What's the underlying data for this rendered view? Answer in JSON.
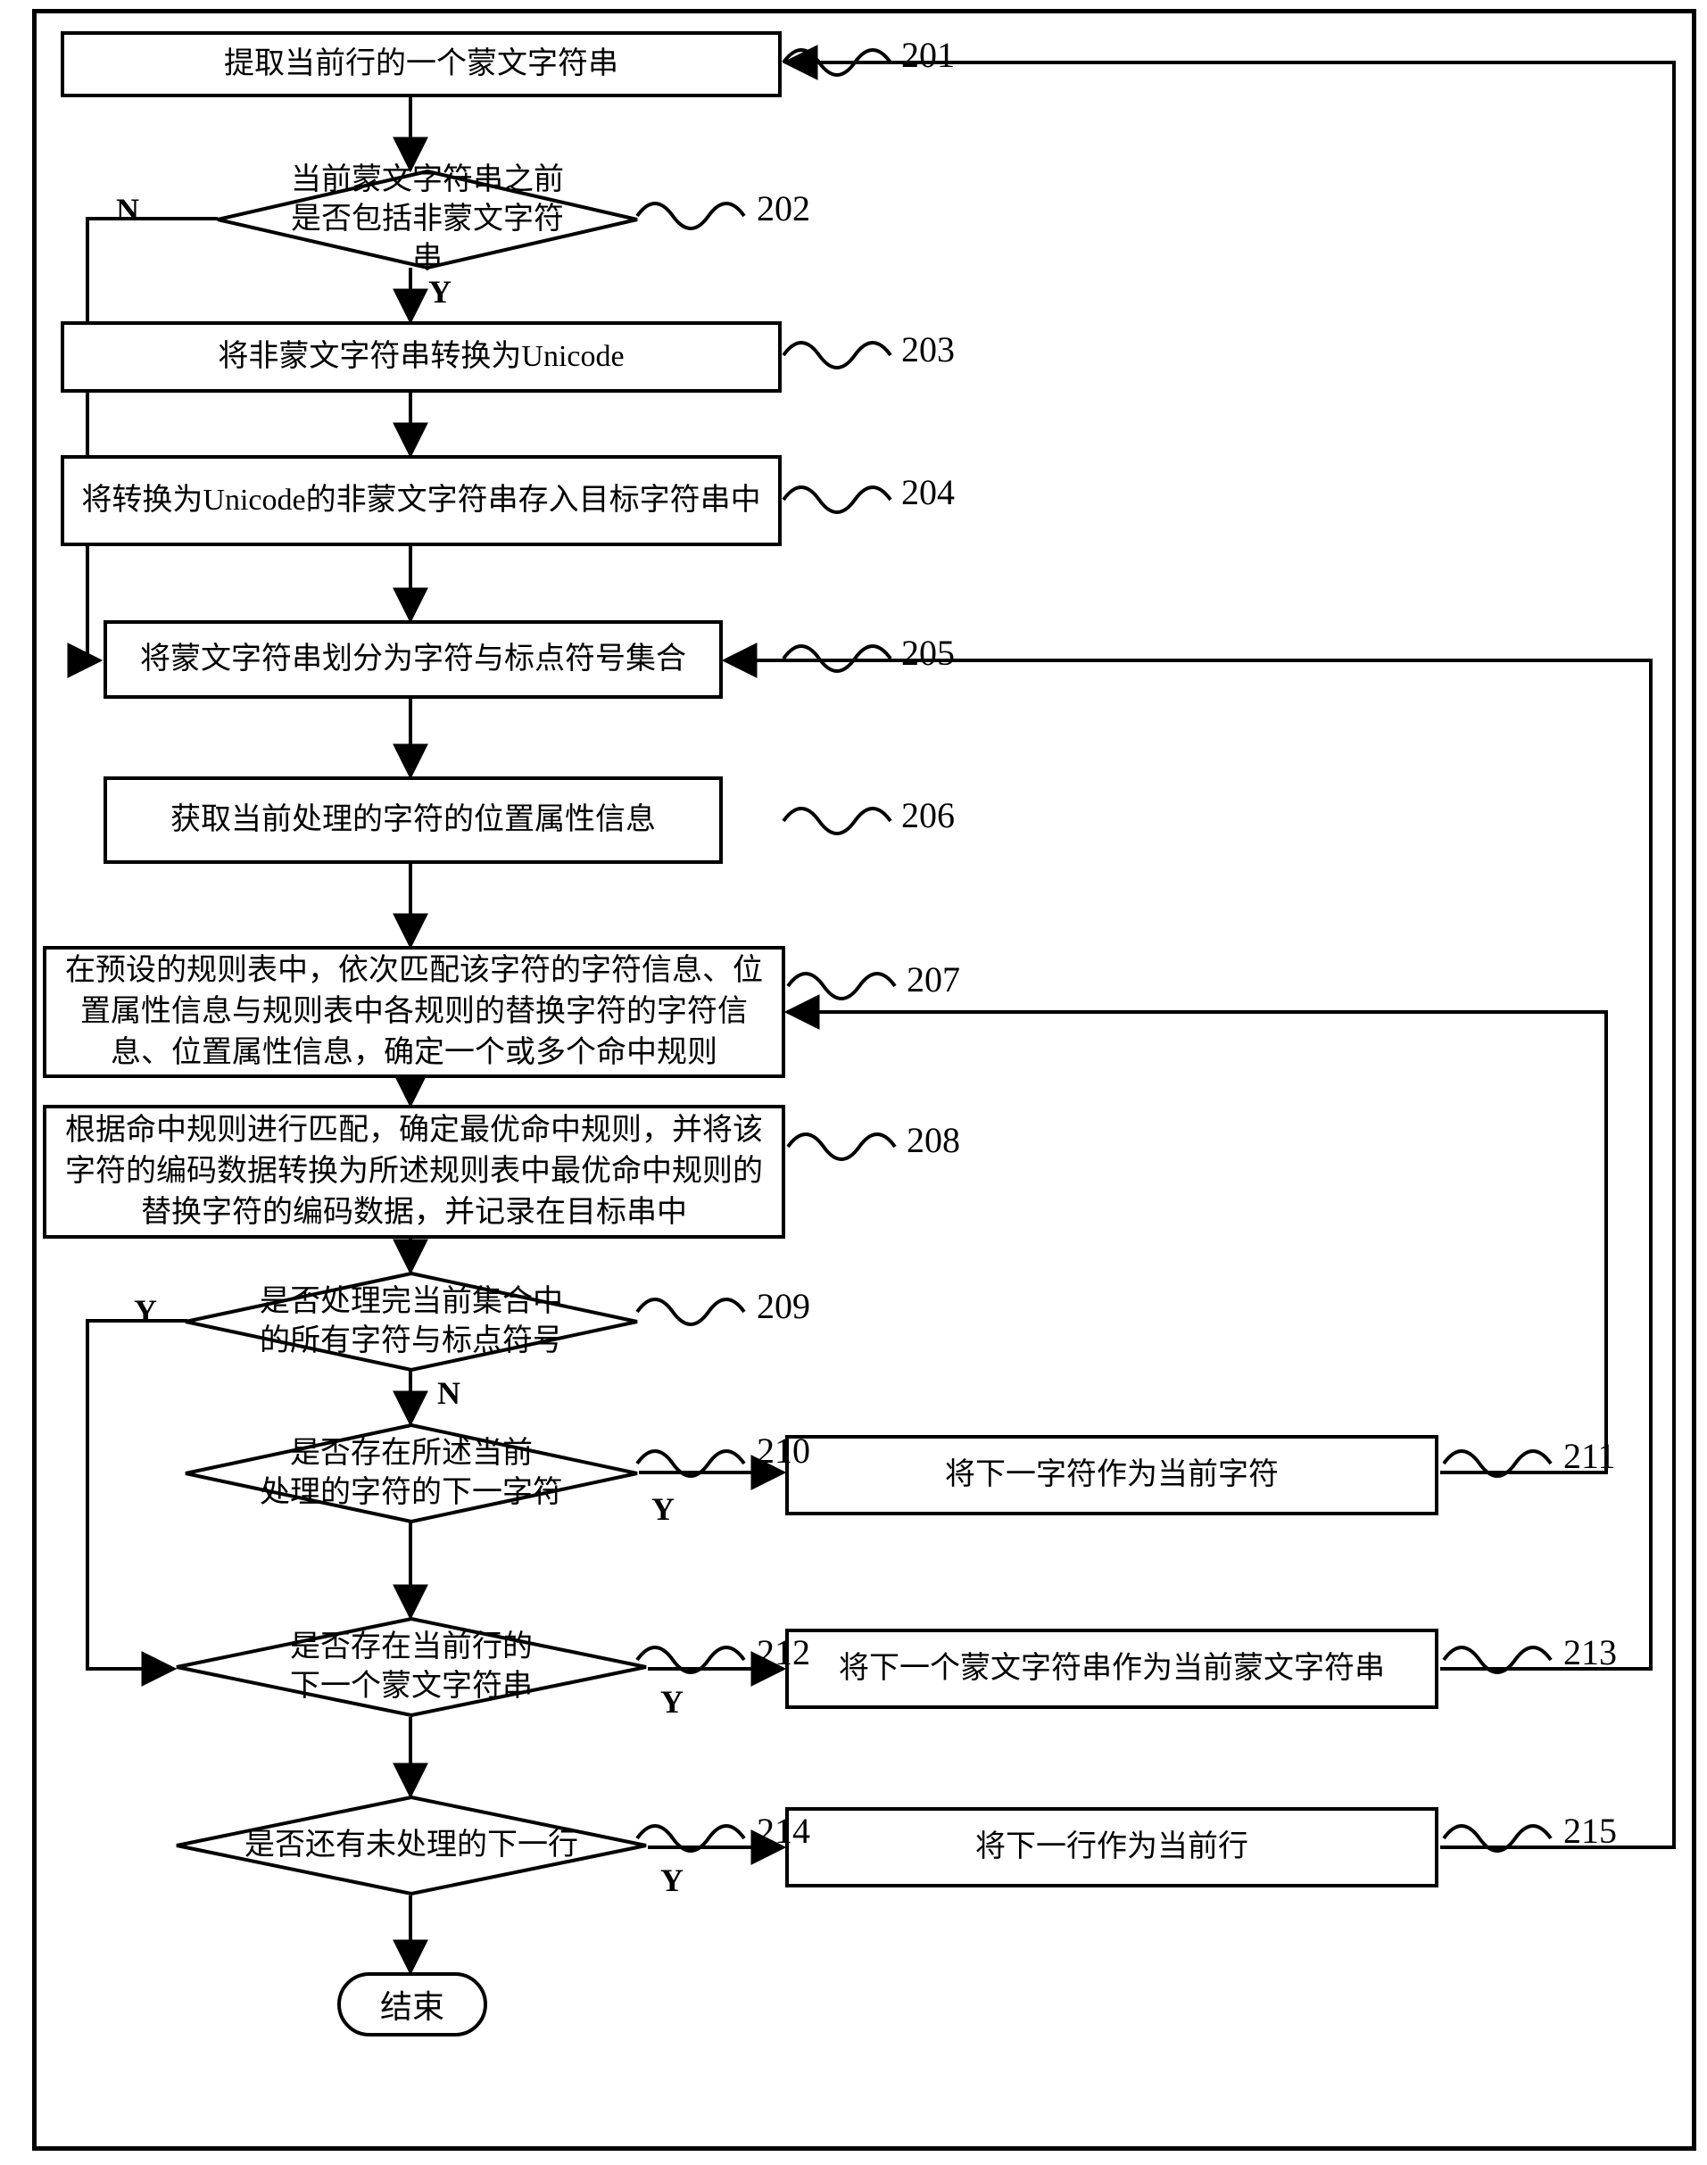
{
  "nodes": {
    "n201": "提取当前行的一个蒙文字符串",
    "n202": "当前蒙文字符串之前\n是否包括非蒙文字符串",
    "n203": "将非蒙文字符串转换为Unicode",
    "n204": "将转换为Unicode的非蒙文字符串存入目标字符串中",
    "n205": "将蒙文字符串划分为字符与标点符号集合",
    "n206": "获取当前处理的字符的位置属性信息",
    "n207": "在预设的规则表中，依次匹配该字符的字符信息、位置属性信息与规则表中各规则的替换字符的字符信息、位置属性信息，确定一个或多个命中规则",
    "n208": "根据命中规则进行匹配，确定最优命中规则，并将该字符的编码数据转换为所述规则表中最优命中规则的替换字符的编码数据，并记录在目标串中",
    "n209": "是否处理完当前集合中\n的所有字符与标点符号",
    "n210": "是否存在所述当前\n处理的字符的下一字符",
    "n211": "将下一字符作为当前字符",
    "n212": "是否存在当前行的\n下一个蒙文字符串",
    "n213": "将下一个蒙文字符串作为当前蒙文字符串",
    "n214": "是否还有未处理的下一行",
    "n215": "将下一行作为当前行",
    "end": "结束"
  },
  "labels": {
    "l201": "201",
    "l202": "202",
    "l203": "203",
    "l204": "204",
    "l205": "205",
    "l206": "206",
    "l207": "207",
    "l208": "208",
    "l209": "209",
    "l210": "210",
    "l211": "211",
    "l212": "212",
    "l213": "213",
    "l214": "214",
    "l215": "215"
  },
  "edges": {
    "Y": "Y",
    "N": "N"
  }
}
